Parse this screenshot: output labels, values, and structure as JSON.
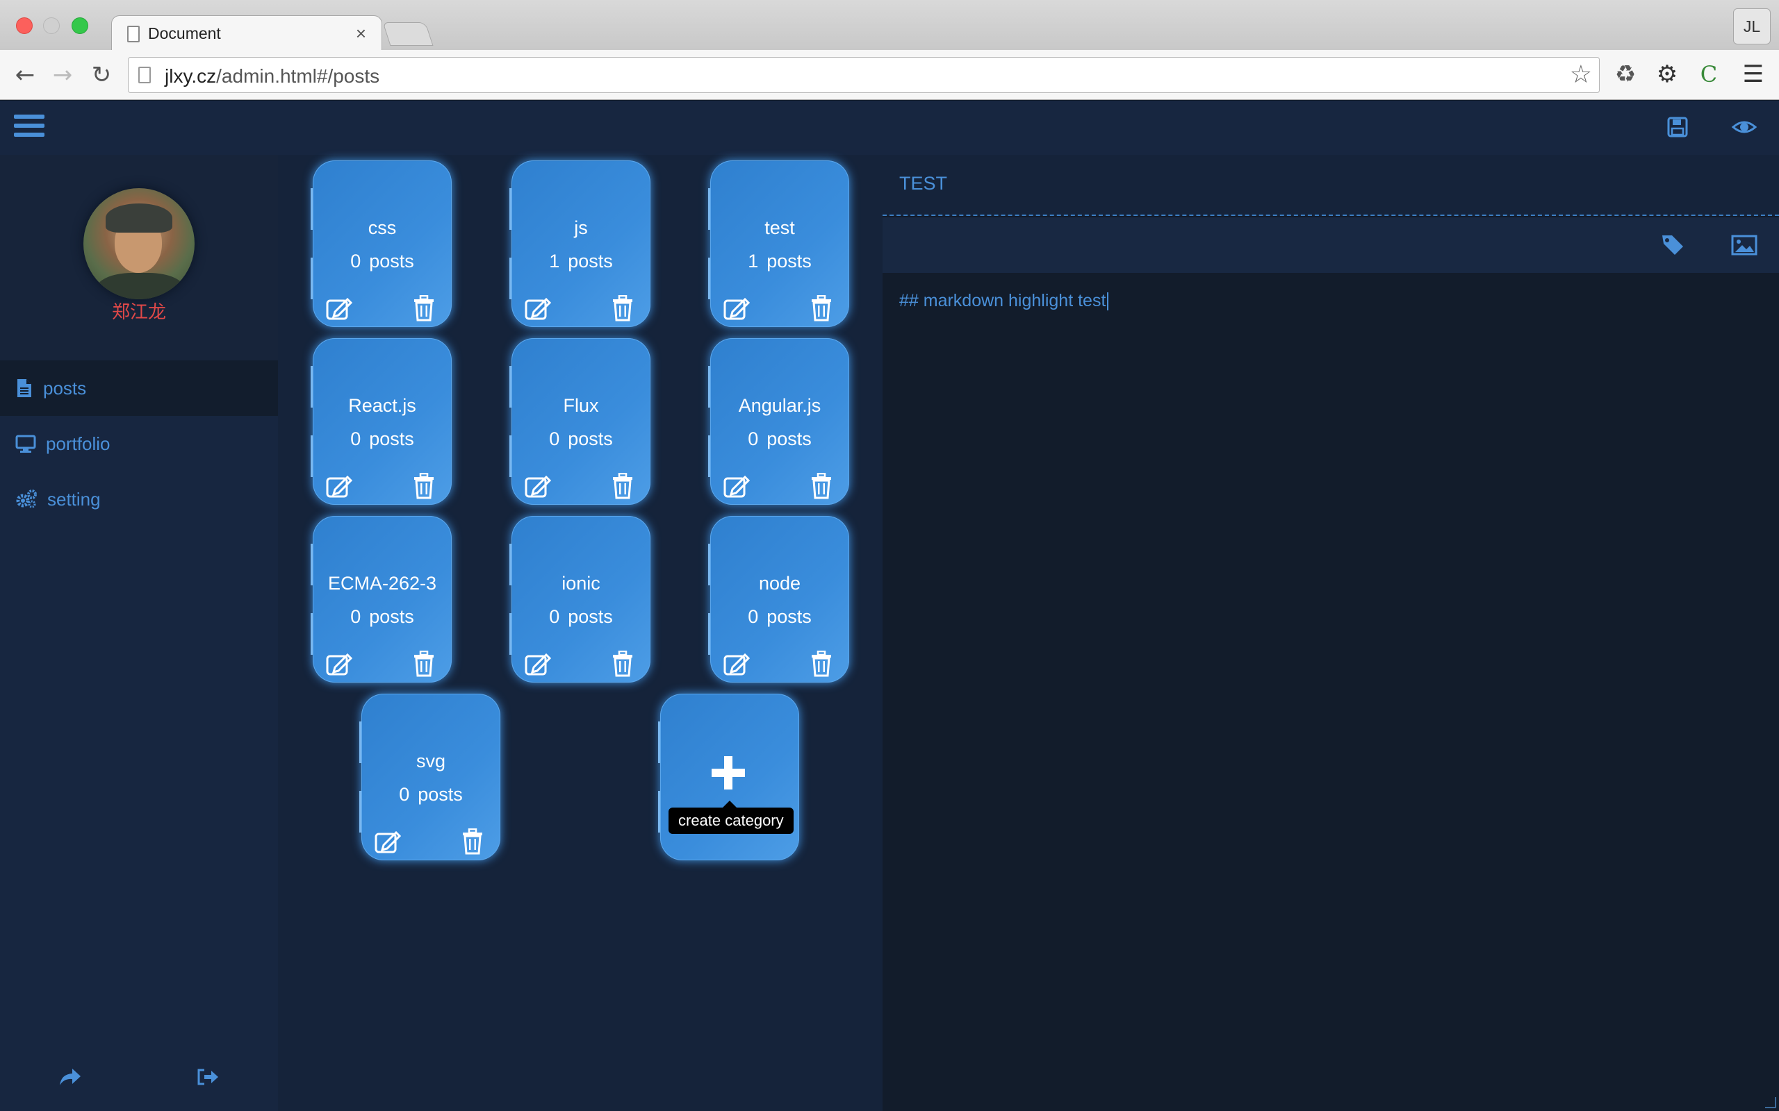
{
  "browser": {
    "tab_title": "Document",
    "tab_close": "×",
    "url_host": "jlxy.cz",
    "url_path": "/admin.html#/posts",
    "profile_initials": "JL",
    "extension_c": "C"
  },
  "user": {
    "name": "郑江龙"
  },
  "nav": {
    "items": [
      {
        "label": "posts",
        "icon": "file-text-icon"
      },
      {
        "label": "portfolio",
        "icon": "desktop-icon"
      },
      {
        "label": "setting",
        "icon": "gears-icon"
      }
    ]
  },
  "categories": [
    {
      "name": "css",
      "count": "0",
      "unit": "posts"
    },
    {
      "name": "js",
      "count": "1",
      "unit": "posts"
    },
    {
      "name": "test",
      "count": "1",
      "unit": "posts"
    },
    {
      "name": "React.js",
      "count": "0",
      "unit": "posts"
    },
    {
      "name": "Flux",
      "count": "0",
      "unit": "posts"
    },
    {
      "name": "Angular.js",
      "count": "0",
      "unit": "posts"
    },
    {
      "name": "ECMA-262-3",
      "count": "0",
      "unit": "posts"
    },
    {
      "name": "ionic",
      "count": "0",
      "unit": "posts"
    },
    {
      "name": "node",
      "count": "0",
      "unit": "posts"
    },
    {
      "name": "svg",
      "count": "0",
      "unit": "posts"
    }
  ],
  "create_category": {
    "tooltip": "create category"
  },
  "editor": {
    "title": "TEST",
    "content": "## markdown highlight test"
  },
  "colors": {
    "accent": "#4a90d9",
    "card": "#3a8ddc",
    "background": "#131e2d",
    "user_name": "#e04848"
  }
}
